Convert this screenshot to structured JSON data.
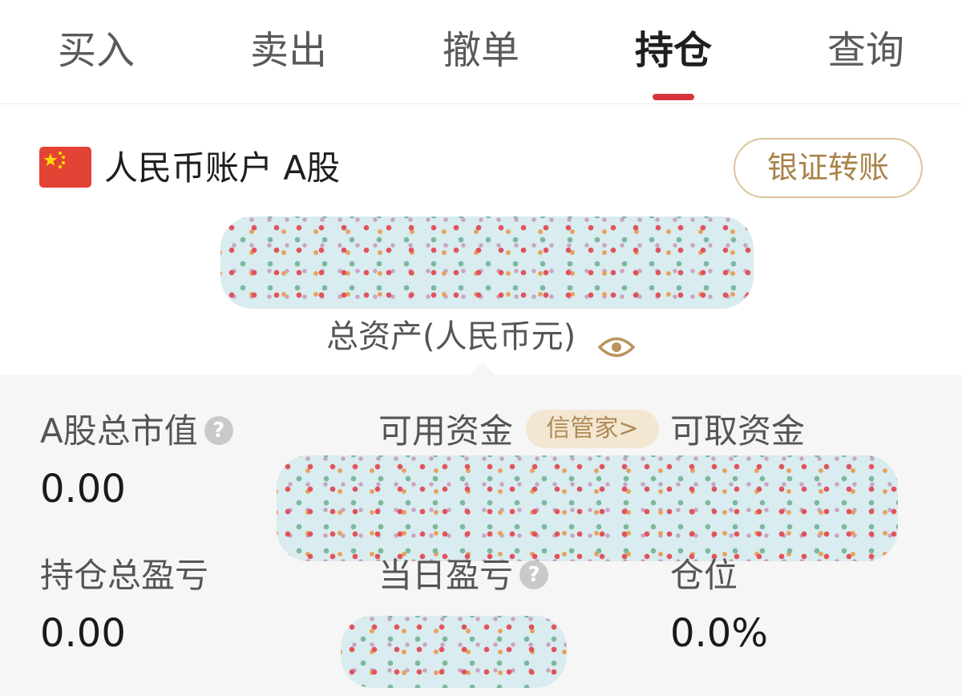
{
  "tabs": [
    {
      "label": "买入"
    },
    {
      "label": "卖出"
    },
    {
      "label": "撤单"
    },
    {
      "label": "持仓",
      "active": true
    },
    {
      "label": "查询"
    }
  ],
  "account": {
    "flag_icon": "china-flag-icon",
    "title": "人民币账户 A股",
    "transfer_button": "银证转账"
  },
  "total_assets": {
    "label": "总资产(人民币元)",
    "eye_icon": "eye-icon"
  },
  "summary": {
    "a_share_market_value": {
      "label": "A股总市值",
      "value": "0.00"
    },
    "available_funds": {
      "label": "可用资金",
      "badge": "信管家>"
    },
    "withdrawable_funds": {
      "label": "可取资金"
    },
    "total_position_pnl": {
      "label": "持仓总盈亏",
      "value": "0.00"
    },
    "daily_pnl": {
      "label": "当日盈亏"
    },
    "position_ratio": {
      "label": "仓位",
      "value": "0.0%"
    }
  },
  "colors": {
    "accent_red": "#d8323a",
    "gold": "#a98349"
  }
}
